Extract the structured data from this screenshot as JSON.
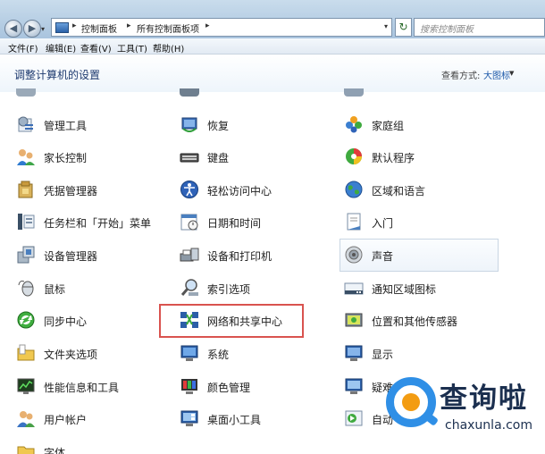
{
  "address_bar": {
    "crumbs": [
      "控制面板",
      "所有控制面板项"
    ],
    "search_placeholder": "搜索控制面板"
  },
  "menu": [
    "文件(F)",
    "编辑(E)",
    "查看(V)",
    "工具(T)",
    "帮助(H)"
  ],
  "header": {
    "title": "调整计算机的设置",
    "view_label": "查看方式:",
    "view_value": "大图标"
  },
  "items": {
    "col1": [
      "管理工具",
      "家长控制",
      "凭据管理器",
      "任务栏和「开始」菜单",
      "设备管理器",
      "鼠标",
      "同步中心",
      "文件夹选项",
      "性能信息和工具",
      "用户帐户",
      "字体"
    ],
    "col2": [
      "恢复",
      "键盘",
      "轻松访问中心",
      "日期和时间",
      "设备和打印机",
      "索引选项",
      "网络和共享中心",
      "系统",
      "颜色管理",
      "桌面小工具"
    ],
    "col3": [
      "家庭组",
      "默认程序",
      "区域和语言",
      "入门",
      "声音",
      "通知区域图标",
      "位置和其他传感器",
      "显示",
      "疑难",
      "自动"
    ]
  },
  "highlighted_item": "网络和共享中心",
  "watermark": {
    "cn": "查询啦",
    "en": "chaxunla.com"
  },
  "colors": {
    "highlight_border": "#d9534f",
    "watermark_blue": "#2f8fe6",
    "watermark_orange": "#f39c12"
  }
}
